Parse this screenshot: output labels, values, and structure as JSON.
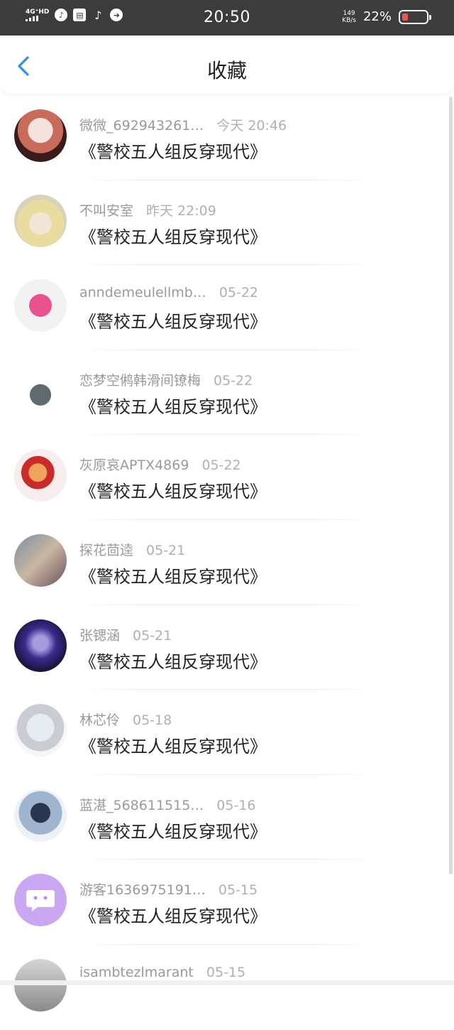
{
  "status_bar": {
    "network": "4G⁺HD",
    "time": "20:50",
    "speed_value": "149",
    "speed_unit": "KB/s",
    "battery": "22%"
  },
  "header": {
    "title": "收藏"
  },
  "items": [
    {
      "user": "微微_692943261…",
      "time": "今天 20:46",
      "title": "《警校五人组反穿现代》"
    },
    {
      "user": "不叫安室",
      "time": "昨天 22:09",
      "title": "《警校五人组反穿现代》"
    },
    {
      "user": "anndemeulellmb…",
      "time": "05-22",
      "title": "《警校五人组反穿现代》"
    },
    {
      "user": "恋梦空鸺韩滑间镣梅",
      "time": "05-22",
      "title": "《警校五人组反穿现代》"
    },
    {
      "user": "灰原哀APTX4869",
      "time": "05-22",
      "title": "《警校五人组反穿现代》"
    },
    {
      "user": "探花茴逵",
      "time": "05-21",
      "title": "《警校五人组反穿现代》"
    },
    {
      "user": "张锶涵",
      "time": "05-21",
      "title": "《警校五人组反穿现代》"
    },
    {
      "user": "林芯伶",
      "time": "05-18",
      "title": "《警校五人组反穿现代》"
    },
    {
      "user": "蓝湛_568611515…",
      "time": "05-16",
      "title": "《警校五人组反穿现代》"
    },
    {
      "user": "游客1636975191…",
      "time": "05-15",
      "title": "《警校五人组反穿现代》"
    },
    {
      "user": "isambtezlmarant",
      "time": "05-15",
      "title": ""
    }
  ],
  "colors": {
    "accent": "#2f8ef0",
    "status_bar_bg": "#3c3c3c"
  }
}
